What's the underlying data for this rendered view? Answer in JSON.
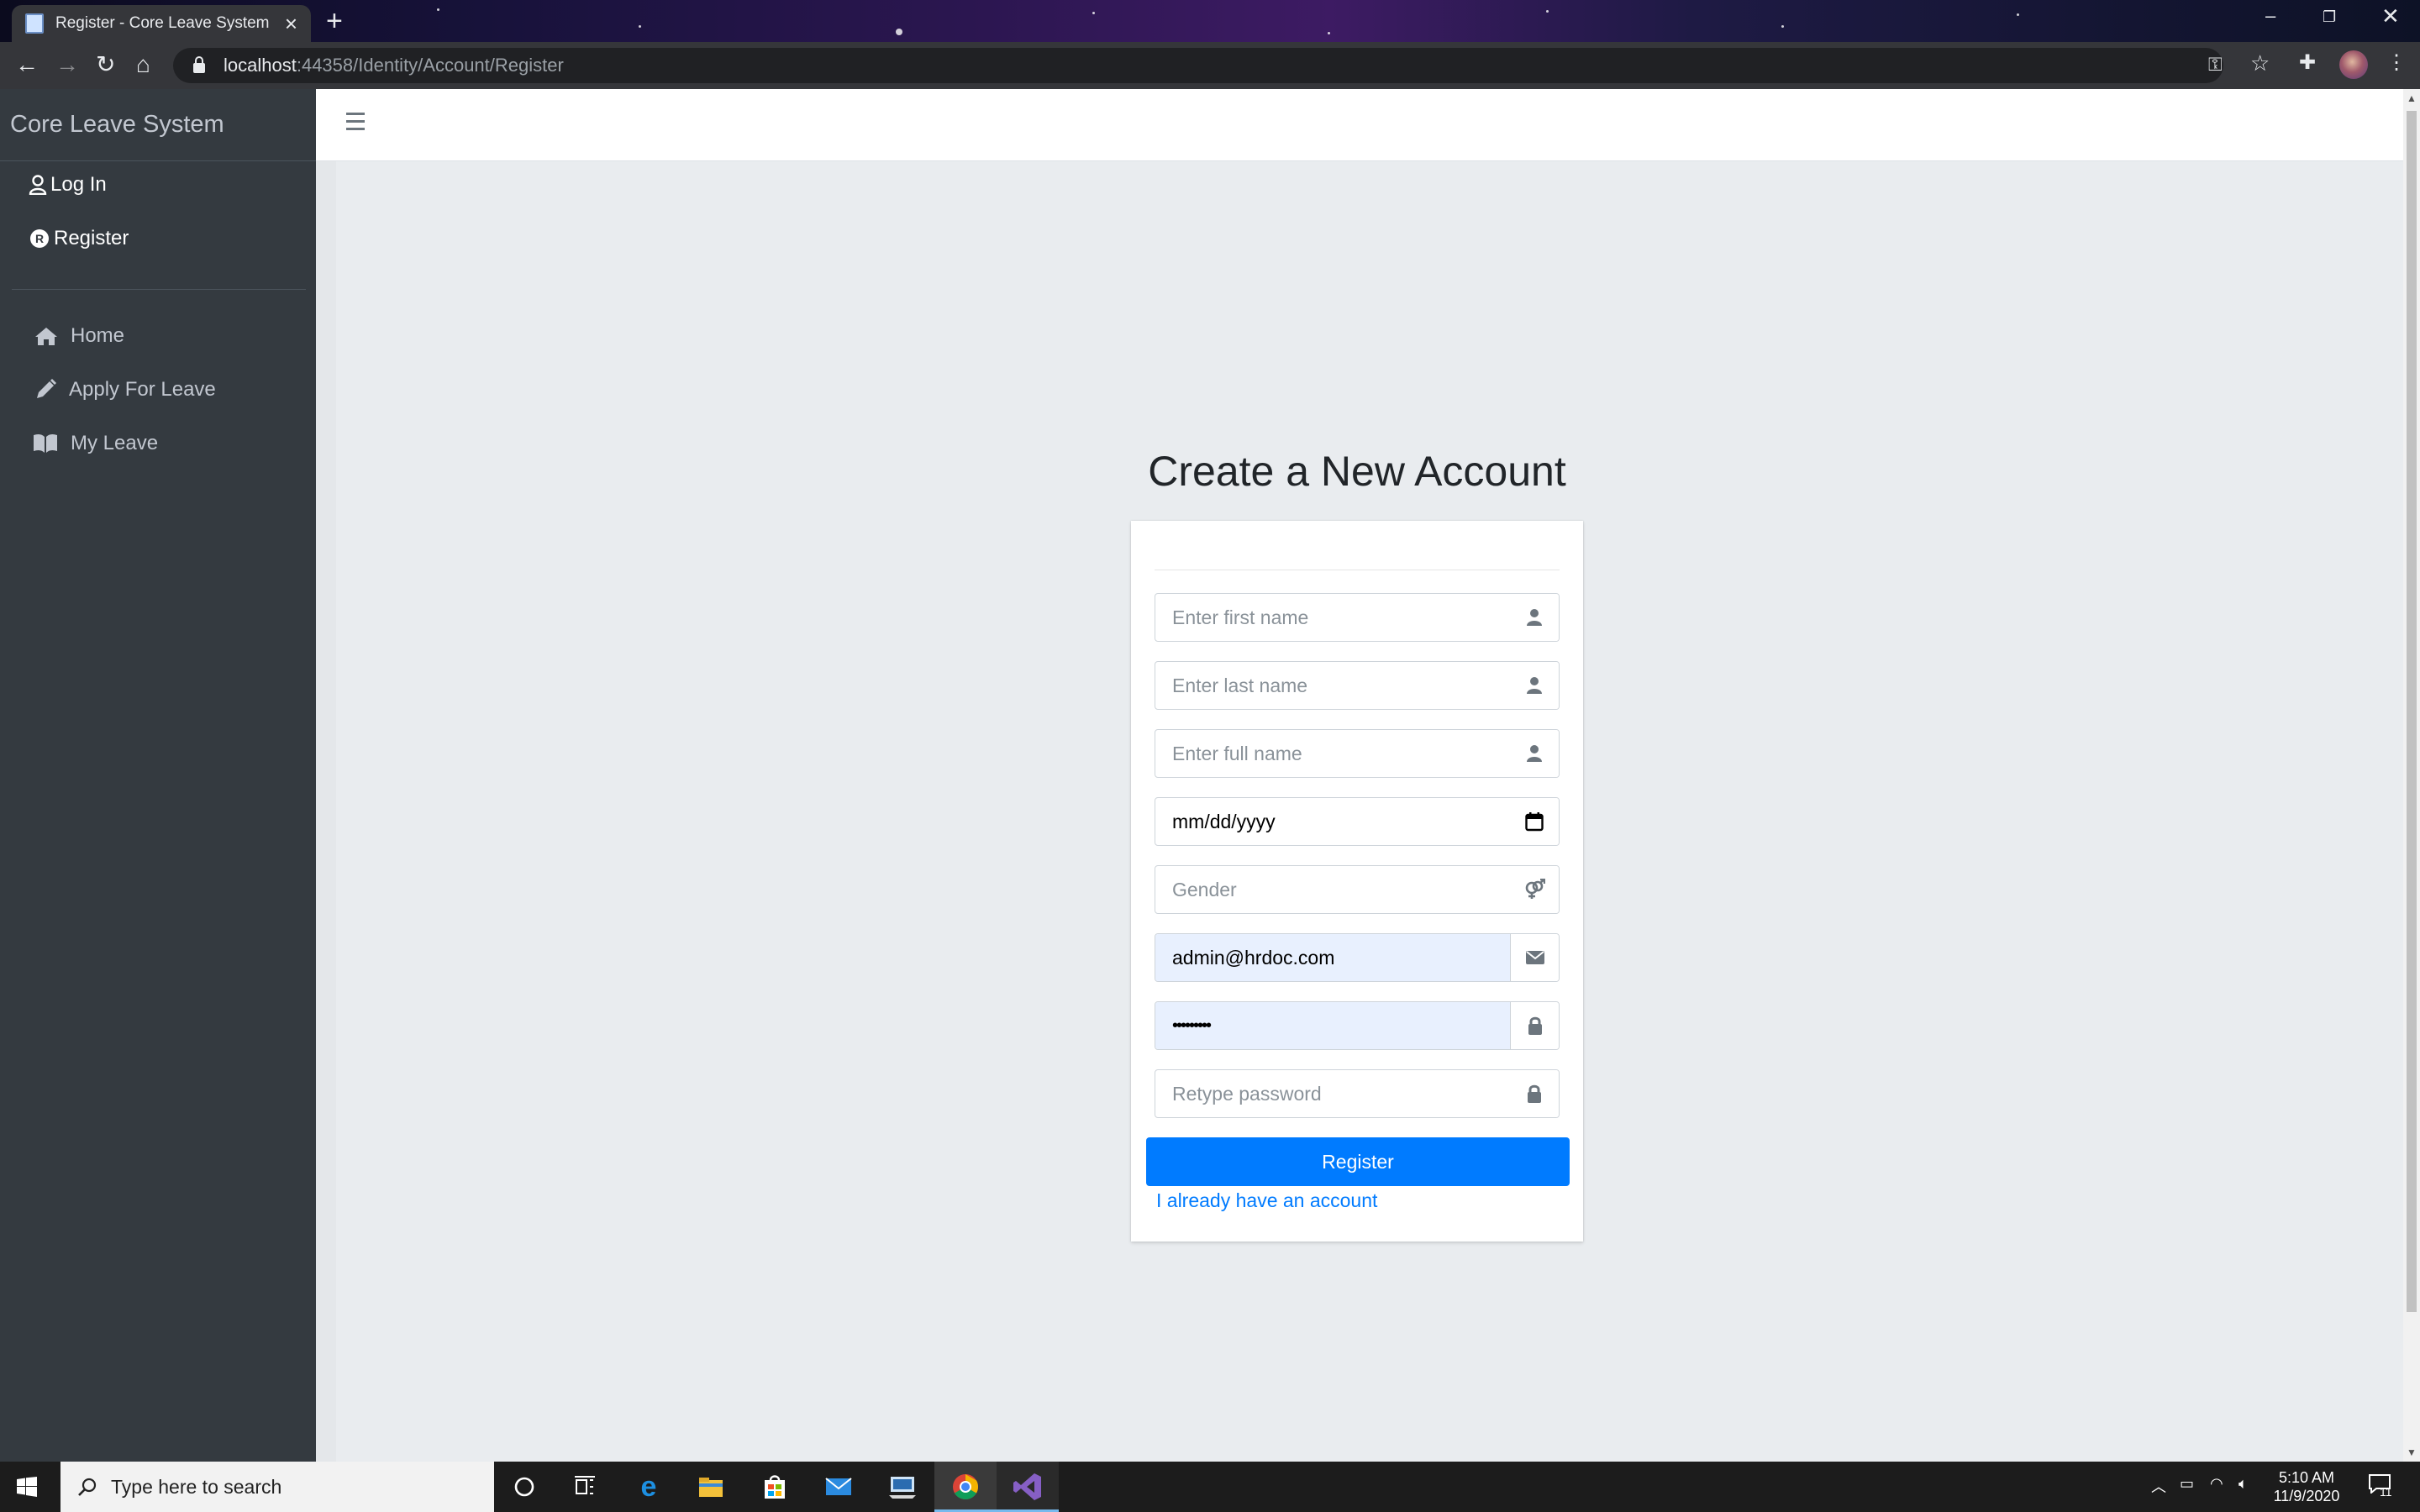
{
  "browser": {
    "tab_title": "Register - Core Leave System",
    "new_tab": "+",
    "url_host": "localhost",
    "url_path": ":44358/Identity/Account/Register"
  },
  "sidebar": {
    "brand": "Core Leave System",
    "account_items": [
      {
        "label": "Log In",
        "icon": "user-icon"
      },
      {
        "label": "Register",
        "icon": "registered-icon"
      }
    ],
    "nav_items": [
      {
        "label": "Home",
        "icon": "home-icon"
      },
      {
        "label": "Apply For Leave",
        "icon": "pencil-icon"
      },
      {
        "label": "My Leave",
        "icon": "book-icon"
      }
    ]
  },
  "form": {
    "title": "Create a New Account",
    "first_name_placeholder": "Enter first name",
    "last_name_placeholder": "Enter last name",
    "full_name_placeholder": "Enter full name",
    "date_placeholder": "mm/dd/yyyy",
    "gender_placeholder": "Gender",
    "email_value": "admin@hrdoc.com",
    "password_value": "•••••••••",
    "retype_placeholder": "Retype password",
    "submit_label": "Register",
    "login_link": "I already have an account"
  },
  "taskbar": {
    "search_placeholder": "Type here to search",
    "time": "5:10 AM",
    "date": "11/9/2020",
    "notifications": "11"
  },
  "colors": {
    "primary": "#007bff",
    "sidebar_bg": "#343a40",
    "content_bg": "#e9ecef",
    "autofill_bg": "#e8f0fe"
  }
}
